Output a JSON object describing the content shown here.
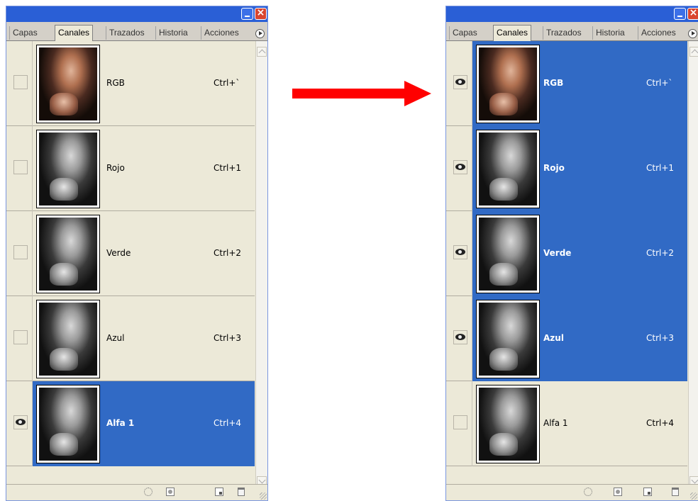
{
  "tabs": [
    "Capas",
    "Canales",
    "Trazados",
    "Historia",
    "Acciones"
  ],
  "active_tab": "Canales",
  "panels": {
    "before": {
      "channels": [
        {
          "name": "RGB",
          "shortcut": "Ctrl+`",
          "visible": false,
          "selected": false
        },
        {
          "name": "Rojo",
          "shortcut": "Ctrl+1",
          "visible": false,
          "selected": false
        },
        {
          "name": "Verde",
          "shortcut": "Ctrl+2",
          "visible": false,
          "selected": false
        },
        {
          "name": "Azul",
          "shortcut": "Ctrl+3",
          "visible": false,
          "selected": false
        },
        {
          "name": "Alfa 1",
          "shortcut": "Ctrl+4",
          "visible": true,
          "selected": true
        }
      ]
    },
    "after": {
      "channels": [
        {
          "name": "RGB",
          "shortcut": "Ctrl+`",
          "visible": true,
          "selected": true
        },
        {
          "name": "Rojo",
          "shortcut": "Ctrl+1",
          "visible": true,
          "selected": true
        },
        {
          "name": "Verde",
          "shortcut": "Ctrl+2",
          "visible": true,
          "selected": true
        },
        {
          "name": "Azul",
          "shortcut": "Ctrl+3",
          "visible": true,
          "selected": true
        },
        {
          "name": "Alfa 1",
          "shortcut": "Ctrl+4",
          "visible": false,
          "selected": false
        }
      ]
    }
  },
  "footer_icons": [
    "load-selection-icon",
    "save-selection-icon",
    "new-channel-icon",
    "delete-channel-icon"
  ],
  "colors": {
    "selection": "#316ac5",
    "panel_bg": "#ece9d8",
    "titlebar": "#2a5fd6",
    "arrow": "#ff0000"
  }
}
